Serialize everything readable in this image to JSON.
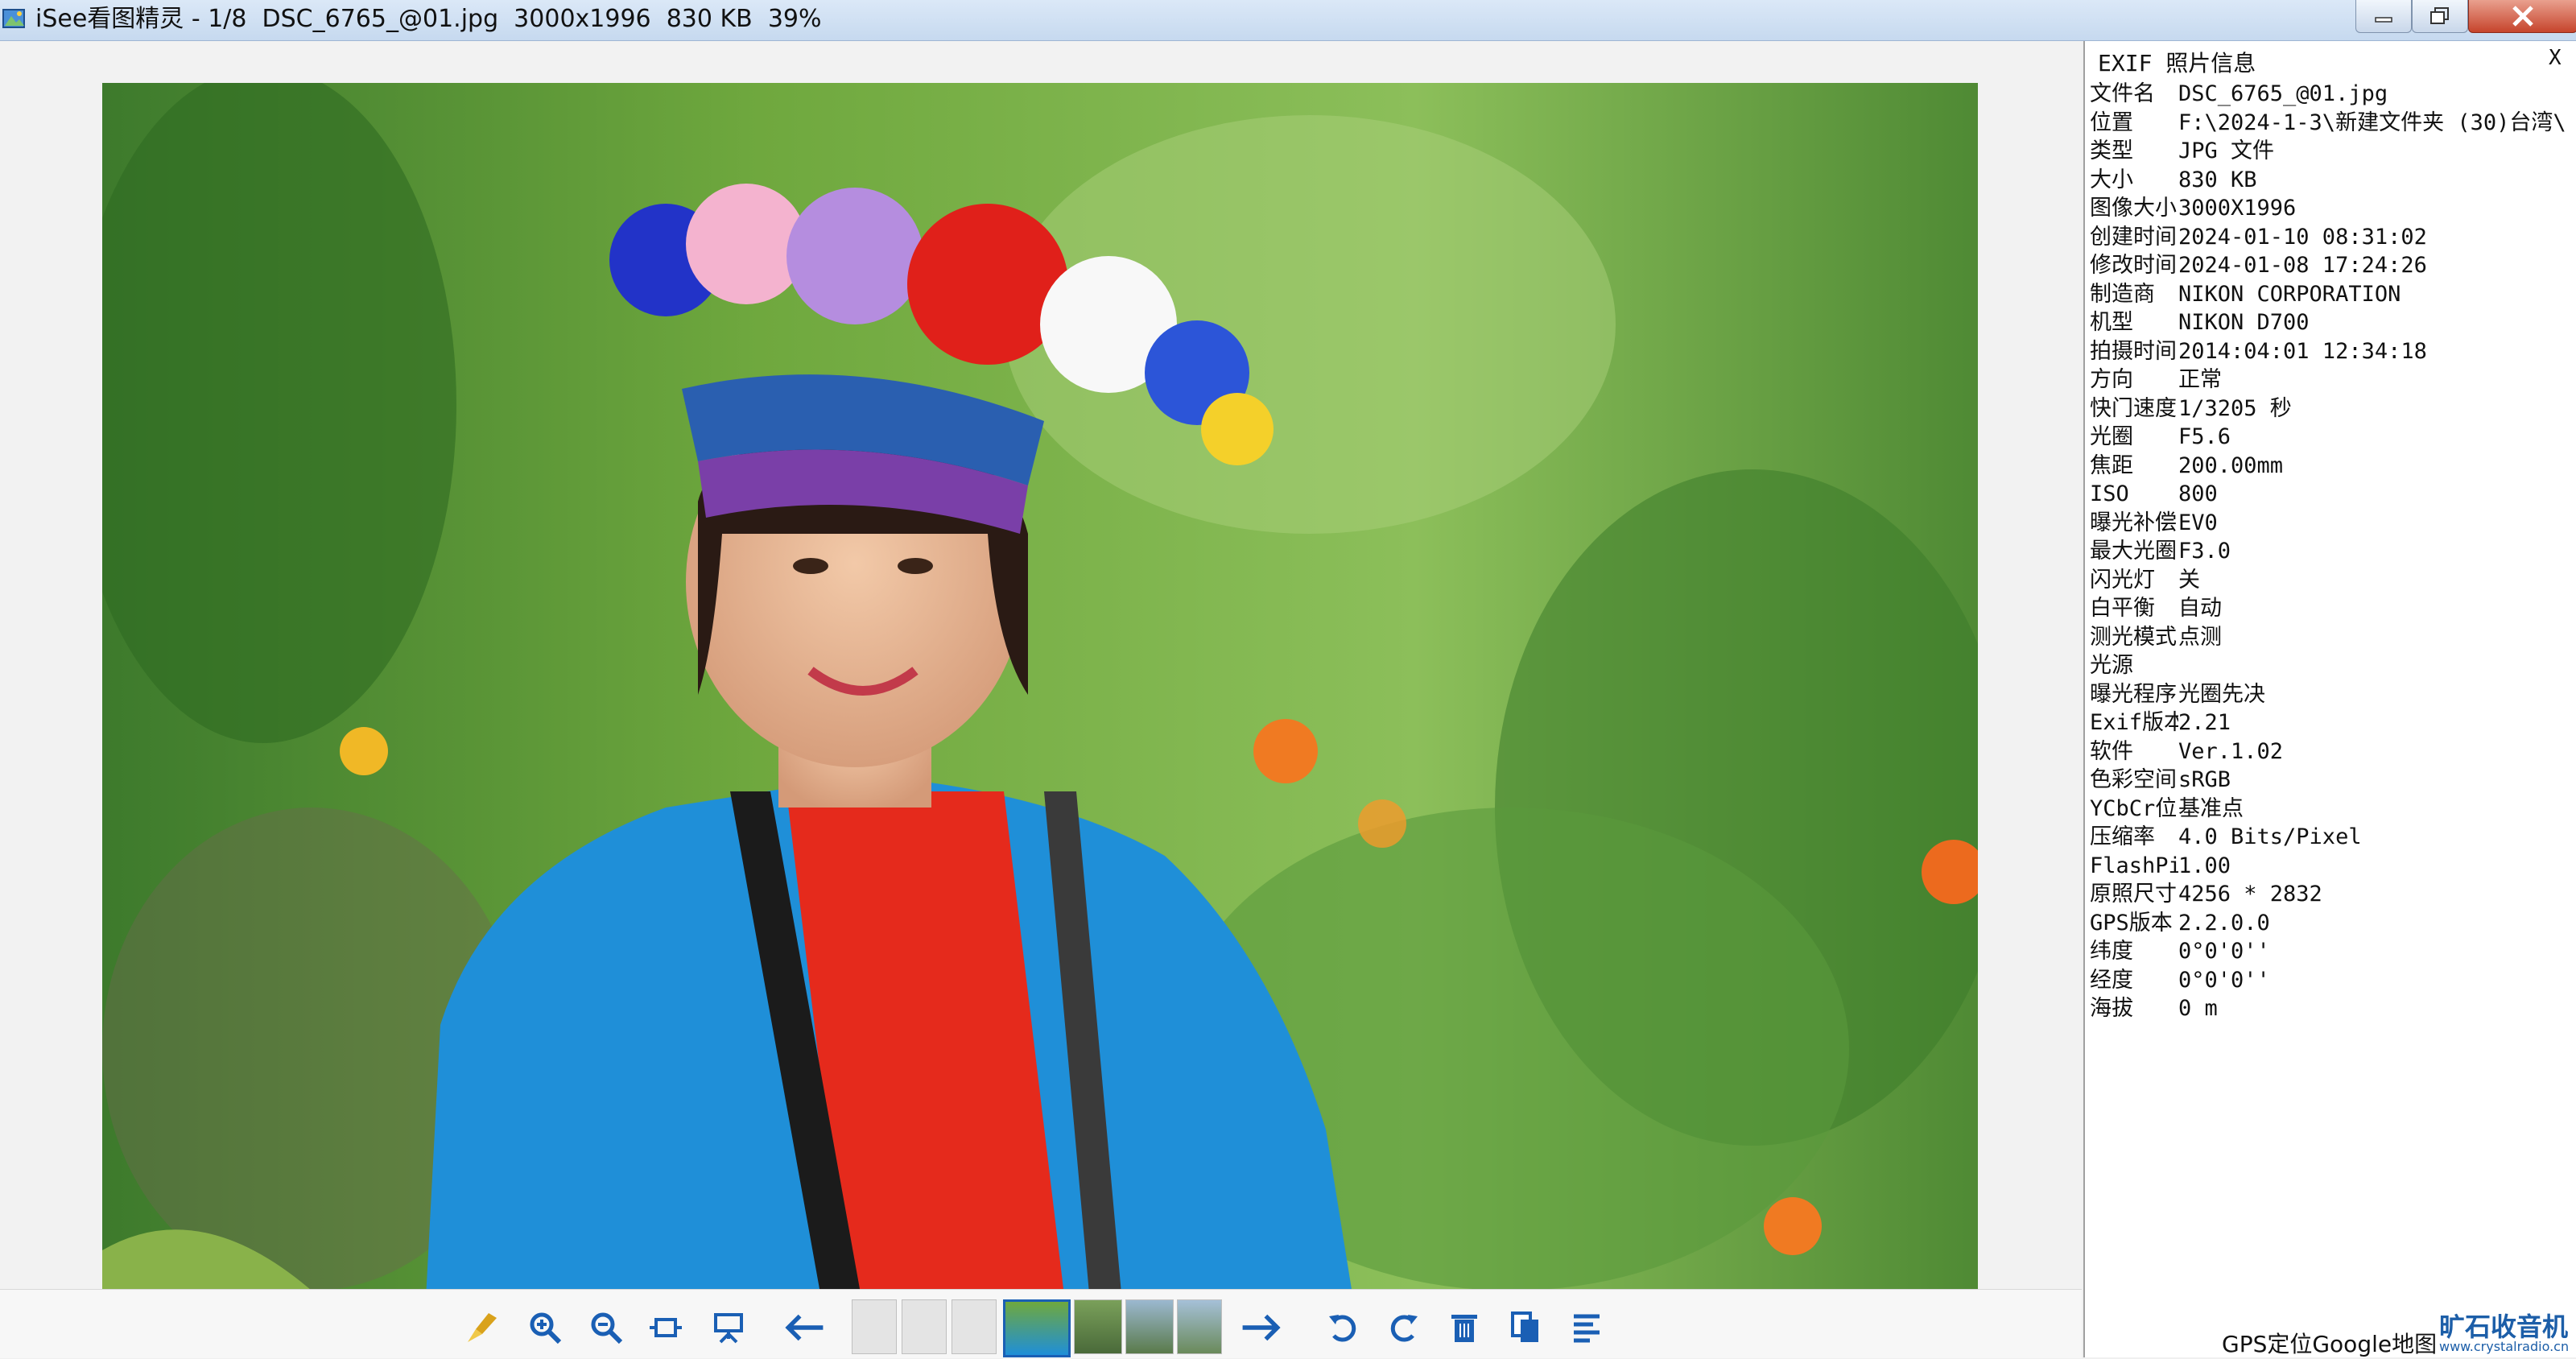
{
  "window": {
    "title": "iSee看图精灵 - 1/8  DSC_6765_@01.jpg  3000x1996  830 KB  39%",
    "controls": [
      "minimize",
      "maximize",
      "close"
    ]
  },
  "toolbar": {
    "buttons": [
      {
        "name": "clean-icon"
      },
      {
        "name": "zoom-in-icon"
      },
      {
        "name": "zoom-out-icon"
      },
      {
        "name": "fit-window-icon"
      },
      {
        "name": "slideshow-icon"
      },
      {
        "name": "prev-arrow-icon"
      },
      {
        "name": "next-arrow-icon"
      },
      {
        "name": "rotate-left-icon"
      },
      {
        "name": "rotate-right-icon"
      },
      {
        "name": "delete-icon"
      },
      {
        "name": "copy-icon"
      },
      {
        "name": "info-icon"
      }
    ],
    "thumbnails": 7
  },
  "exif": {
    "header": "EXIF 照片信息",
    "close": "X",
    "rows": [
      {
        "k": "文件名",
        "v": "DSC_6765_@01.jpg"
      },
      {
        "k": "位置",
        "v": "F:\\2024-1-3\\新建文件夹 (30)台湾\\"
      },
      {
        "k": "类型",
        "v": "JPG 文件"
      },
      {
        "k": "大小",
        "v": "830 KB"
      },
      {
        "k": "图像大小",
        "v": "3000X1996"
      },
      {
        "k": "创建时间",
        "v": "2024-01-10 08:31:02"
      },
      {
        "k": "修改时间",
        "v": "2024-01-08 17:24:26"
      },
      {
        "k": "制造商",
        "v": "NIKON CORPORATION"
      },
      {
        "k": "机型",
        "v": "NIKON D700"
      },
      {
        "k": "拍摄时间",
        "v": "2014:04:01 12:34:18"
      },
      {
        "k": "方向",
        "v": "正常"
      },
      {
        "k": "快门速度",
        "v": "1/3205 秒"
      },
      {
        "k": "光圈",
        "v": "F5.6"
      },
      {
        "k": "焦距",
        "v": "200.00mm"
      },
      {
        "k": "ISO",
        "v": "800"
      },
      {
        "k": "曝光补偿",
        "v": "EV0"
      },
      {
        "k": "最大光圈",
        "v": "F3.0"
      },
      {
        "k": "闪光灯",
        "v": "关"
      },
      {
        "k": "白平衡",
        "v": "自动"
      },
      {
        "k": "测光模式",
        "v": "点测"
      },
      {
        "k": "光源",
        "v": ""
      },
      {
        "k": "曝光程序",
        "v": "光圈先决"
      },
      {
        "k": "Exif版本",
        "v": "2.21"
      },
      {
        "k": "软件",
        "v": "Ver.1.02"
      },
      {
        "k": "色彩空间",
        "v": "sRGB"
      },
      {
        "k": "YCbCr位",
        "v": "基准点"
      },
      {
        "k": "压缩率",
        "v": "4.0 Bits/Pixel"
      },
      {
        "k": "FlashPix",
        "v": "1.00"
      },
      {
        "k": "原照尺寸",
        "v": "4256 * 2832"
      },
      {
        "k": "GPS版本",
        "v": "2.2.0.0"
      },
      {
        "k": "纬度",
        "v": " 0°0'0''"
      },
      {
        "k": "经度",
        "v": " 0°0'0''"
      },
      {
        "k": "海拔",
        "v": "0 m"
      }
    ],
    "gps_link": "GPS定位Google地图"
  },
  "watermark": {
    "top": "旷石收音机",
    "bottom": "www.crystalradio.cn"
  },
  "colors": {
    "titlebar": "#c6d9ef",
    "accent": "#1a5fb4",
    "close": "#c6442c"
  }
}
